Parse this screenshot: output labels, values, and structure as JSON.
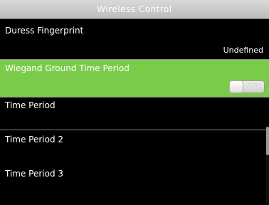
{
  "title": "Wireless Control",
  "items": [
    {
      "label": "Duress Fingerprint",
      "value": "Undefined"
    },
    {
      "label": "Wiegand Ground Time Period",
      "toggle": "OFF"
    },
    {
      "label": "Time Period",
      "value": ""
    },
    {
      "label": "Time Period 2",
      "value": ""
    },
    {
      "label": "Time Period 3",
      "value": ""
    }
  ],
  "colors": {
    "highlight": "#7bcb4a",
    "background": "#000000",
    "titlebar": "#c8c8c8"
  }
}
